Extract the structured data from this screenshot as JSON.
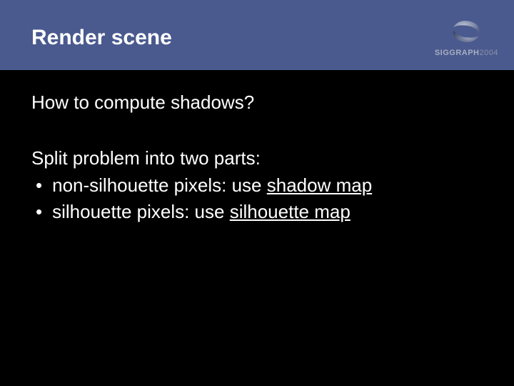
{
  "header": {
    "title": "Render scene",
    "brand_name": "SIGGRAPH",
    "brand_year": "2004"
  },
  "content": {
    "question": "How to compute shadows?",
    "intro": "Split problem into two parts:",
    "bullets": [
      {
        "prefix": "non-silhouette pixels: use ",
        "emph": "shadow map"
      },
      {
        "prefix": "silhouette pixels: use ",
        "emph": "silhouette map"
      }
    ]
  }
}
